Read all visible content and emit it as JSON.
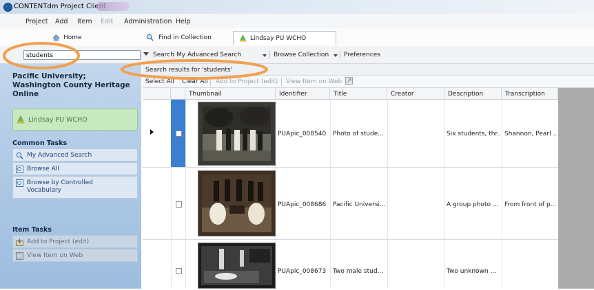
{
  "window": {
    "title": "CONTENTdm Project Client"
  },
  "menu": [
    "Project",
    "Add",
    "Item",
    "Edit",
    "Administration",
    "Help"
  ],
  "tabs": [
    {
      "label": "Home",
      "icon": "home-icon"
    },
    {
      "label": "Find in Collection",
      "icon": "find-icon"
    },
    {
      "label": "Lindsay PU WCHO",
      "icon": "collection-icon"
    }
  ],
  "search": {
    "value": "students",
    "button_label": "Search",
    "advanced_label": "My Advanced Search",
    "browse_label": "Browse Collection",
    "preferences_label": "Preferences"
  },
  "sidebar": {
    "collection_name": "Pacific University; Washington County Heritage Online",
    "collection_label": "Lindsay PU WCHO",
    "common_tasks_title": "Common Tasks",
    "common_tasks": [
      {
        "label": "My Advanced Search",
        "icon": "search-icon"
      },
      {
        "label": "Browse All",
        "icon": "browse-icon"
      },
      {
        "label": "Browse by Controlled\nVocabulary",
        "icon": "vocabulary-icon"
      }
    ],
    "item_tasks_title": "Item Tasks",
    "item_tasks": [
      {
        "label": "Add to Project (edit)",
        "icon": "add-project-icon"
      },
      {
        "label": "View Item on Web",
        "icon": "web-icon"
      }
    ]
  },
  "results": {
    "title": "Search results for 'students'",
    "toolbar": {
      "select_all": "Select All",
      "clear_all": "Clear All",
      "add_to_project": "Add to Project (edit)",
      "view_on_web": "View Item on Web"
    },
    "columns": [
      "Thumbnail",
      "Identifier",
      "Title",
      "Creator",
      "Description",
      "Transcription"
    ],
    "rows": [
      {
        "identifier": "PUApic_008540",
        "title": "Photo of stude...",
        "creator": "",
        "description": "Six students, thr...",
        "transcription": "Shannon, Pearl ...",
        "selected": true
      },
      {
        "identifier": "PUApic_008686",
        "title": "Pacific Universi...",
        "creator": "",
        "description": "A group photo ...",
        "transcription": "From front of p...",
        "selected": false
      },
      {
        "identifier": "PUApic_008673",
        "title": "Two male stud...",
        "creator": "",
        "description": "Two unknown ...",
        "transcription": "",
        "selected": false
      }
    ]
  },
  "colors": {
    "sidebar": "#aac6e4",
    "selection": "#3a7fd0",
    "highlight_ring": "#f0a050"
  }
}
